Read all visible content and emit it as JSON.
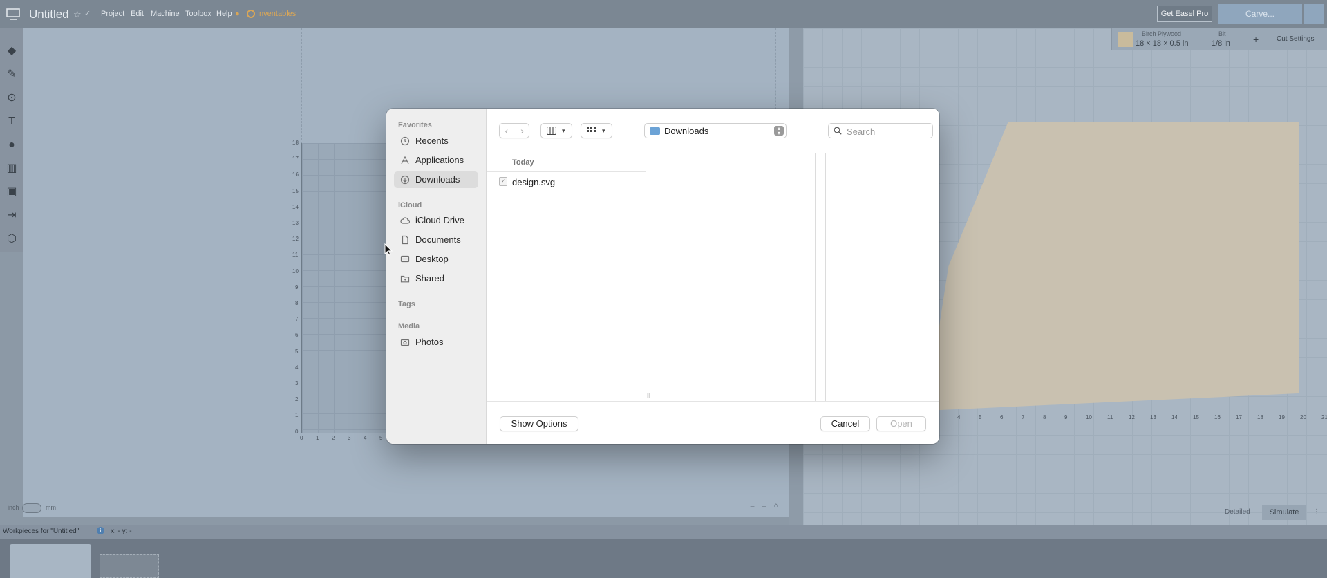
{
  "app": {
    "title": "Untitled",
    "menu": [
      "Project",
      "Edit",
      "Machine",
      "Toolbox",
      "Help"
    ],
    "inventables": "Inventables",
    "get_pro": "Get Easel Pro",
    "carve": "Carve...",
    "material": {
      "name": "Birch Plywood",
      "size": "18 × 18 × 0.5 in",
      "bit_label": "Bit",
      "bit": "1/8 in",
      "cut_settings": "Cut Settings"
    },
    "units": {
      "left": "inch",
      "right": "mm"
    },
    "detailed": "Detailed",
    "simulate": "Simulate",
    "workpieces": "Workpieces for \"Untitled\"",
    "coords": "x: - y: -",
    "y_ticks": [
      "18",
      "17",
      "16",
      "15",
      "14",
      "13",
      "12",
      "11",
      "10",
      "9",
      "8",
      "7",
      "6",
      "5",
      "4",
      "3",
      "2",
      "1",
      "0"
    ],
    "x_ticks": [
      "0",
      "1",
      "2",
      "3",
      "4",
      "5"
    ],
    "x3d_ticks": [
      "4",
      "5",
      "6",
      "7",
      "8",
      "9",
      "10",
      "11",
      "12",
      "13",
      "14",
      "15",
      "16",
      "17",
      "18",
      "19",
      "20",
      "21"
    ]
  },
  "dialog": {
    "sidebar": {
      "favorites_head": "Favorites",
      "favorites": [
        {
          "label": "Recents",
          "icon": "clock-icon"
        },
        {
          "label": "Applications",
          "icon": "applications-icon"
        },
        {
          "label": "Downloads",
          "icon": "download-icon"
        }
      ],
      "icloud_head": "iCloud",
      "icloud": [
        {
          "label": "iCloud Drive",
          "icon": "cloud-icon"
        },
        {
          "label": "Documents",
          "icon": "document-icon"
        },
        {
          "label": "Desktop",
          "icon": "desktop-icon"
        },
        {
          "label": "Shared",
          "icon": "shared-folder-icon"
        }
      ],
      "tags_head": "Tags",
      "media_head": "Media",
      "media": [
        {
          "label": "Photos",
          "icon": "camera-icon"
        }
      ]
    },
    "location": "Downloads",
    "search_placeholder": "Search",
    "column_header": "Today",
    "files": [
      {
        "name": "design.svg"
      }
    ],
    "show_options": "Show Options",
    "cancel": "Cancel",
    "open": "Open"
  }
}
